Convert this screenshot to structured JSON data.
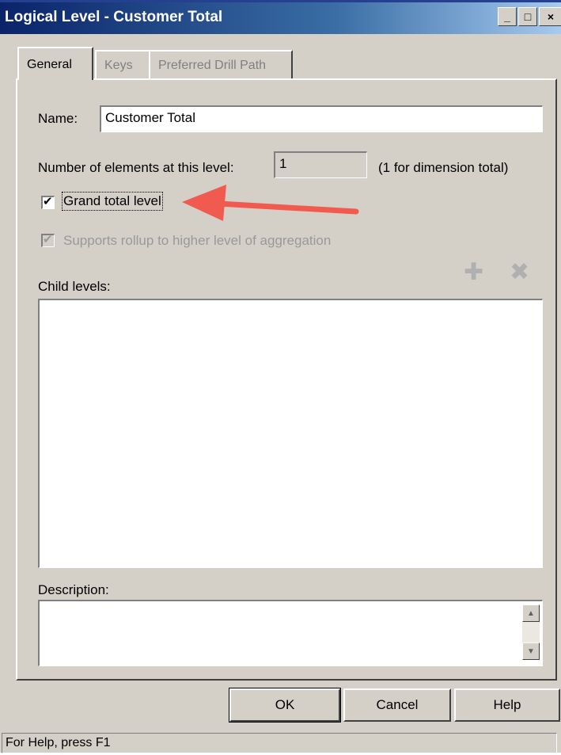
{
  "window": {
    "title": "Logical Level - Customer Total",
    "minimize_label": "_",
    "maximize_label": "□",
    "close_label": "×"
  },
  "tabs": [
    {
      "label": "General",
      "active": true
    },
    {
      "label": "Keys",
      "active": false
    },
    {
      "label": "Preferred Drill Path",
      "active": false
    }
  ],
  "general": {
    "name_label": "Name:",
    "name_value": "Customer Total",
    "num_elements_label": "Number of elements at this level:",
    "num_elements_value": "1",
    "num_elements_hint": "(1 for dimension total)",
    "grand_total_label": "Grand total level",
    "grand_total_checked": true,
    "supports_rollup_label": "Supports rollup to higher level of aggregation",
    "supports_rollup_checked": true,
    "child_levels_label": "Child levels:",
    "description_label": "Description:",
    "add_icon": "plus-icon",
    "delete_icon": "x-icon"
  },
  "buttons": {
    "ok": "OK",
    "cancel": "Cancel",
    "help": "Help"
  },
  "status": {
    "text": "For Help, press F1"
  },
  "colors": {
    "arrow": "#f05a4f",
    "titlebar": "#0a246a"
  }
}
